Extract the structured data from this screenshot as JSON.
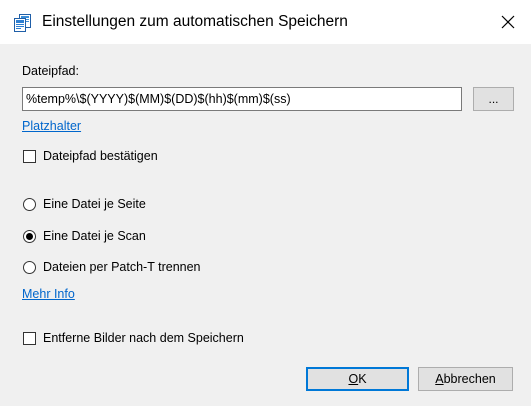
{
  "window": {
    "title": "Einstellungen zum automatischen Speichern",
    "close_glyph": "✕"
  },
  "icons": {
    "title": "app-documents-icon",
    "close": "close-icon"
  },
  "colors": {
    "link": "#0066cc",
    "default_button_border": "#0078d7",
    "client_background": "#f0f0f0"
  },
  "filepath": {
    "label": "Dateipfad:",
    "value": "%temp%\\$(YYYY)$(MM)$(DD)$(hh)$(mm)$(ss)",
    "browse_label": "...",
    "placeholder_link": "Platzhalter"
  },
  "confirm_path": {
    "label": "Dateipfad bestätigen",
    "checked": false
  },
  "split_mode": {
    "options": [
      {
        "label": "Eine Datei je Seite",
        "checked": false
      },
      {
        "label": "Eine Datei je Scan",
        "checked": true
      },
      {
        "label": "Dateien per Patch-T trennen",
        "checked": false
      }
    ],
    "more_info_link": "Mehr Info"
  },
  "remove_images": {
    "label": "Entferne Bilder nach dem Speichern",
    "checked": false
  },
  "buttons": {
    "ok": {
      "mnemonic": "O",
      "rest": "K"
    },
    "cancel": {
      "mnemonic": "A",
      "rest": "bbrechen"
    }
  }
}
